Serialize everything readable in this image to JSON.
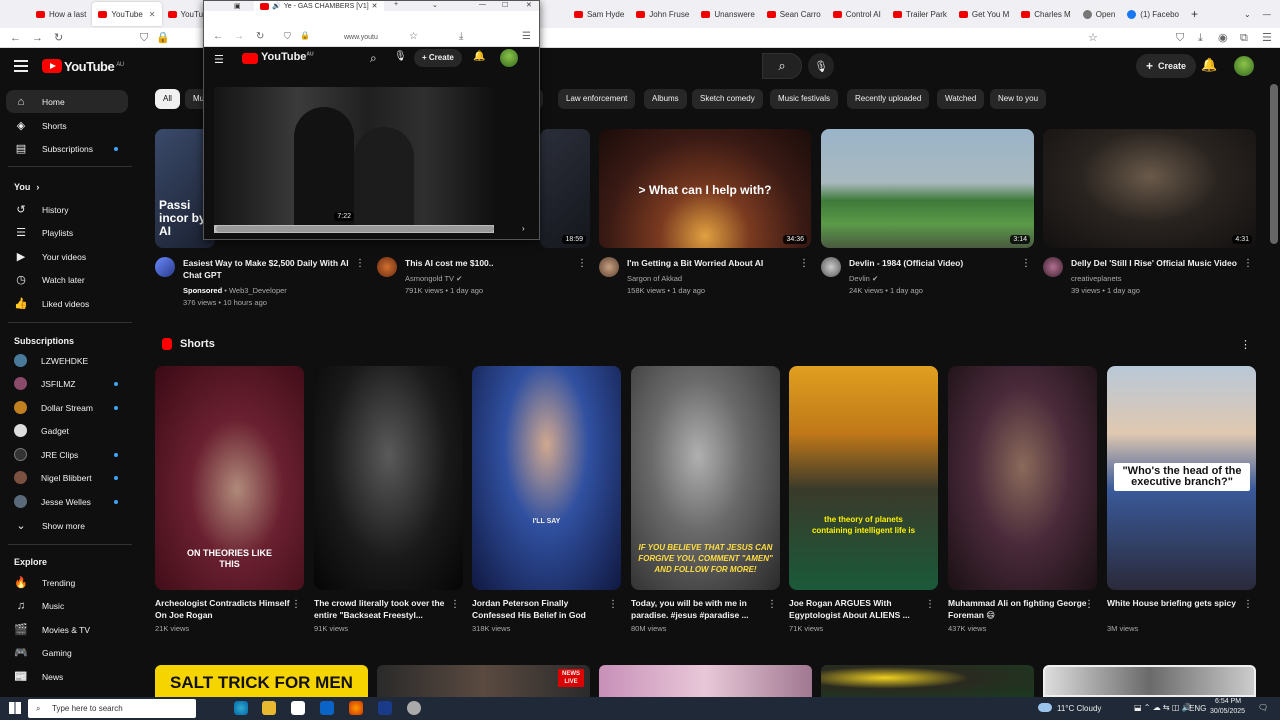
{
  "browser_tabs": [
    {
      "label": "How a last"
    },
    {
      "label": "YouTube",
      "active": true
    },
    {
      "label": "YouTube"
    },
    {
      "label": "Sam Hyde"
    },
    {
      "label": "John Fruse"
    },
    {
      "label": "Unanswere"
    },
    {
      "label": "Sean Carro"
    },
    {
      "label": "Control AI"
    },
    {
      "label": "Trailer Park"
    },
    {
      "label": "Get You M"
    },
    {
      "label": "Charles M"
    },
    {
      "label": "Open"
    },
    {
      "label": "(1) Facebo"
    }
  ],
  "popup": {
    "tab_title": "Ye - GAS CHAMBERS [V1]",
    "url": "www.youtu",
    "create": "Create",
    "logo": "YouTube",
    "region": "AU",
    "time_a": "7:22"
  },
  "header": {
    "logo": "YouTube",
    "region": "AU",
    "create": "Create"
  },
  "sidebar": {
    "main": [
      {
        "label": "Home",
        "icon": "⌂"
      },
      {
        "label": "Shorts",
        "icon": "◈"
      },
      {
        "label": "Subscriptions",
        "icon": "▤",
        "dot": true
      }
    ],
    "you_header": "You",
    "you": [
      {
        "label": "History",
        "icon": "↺"
      },
      {
        "label": "Playlists",
        "icon": "☰"
      },
      {
        "label": "Your videos",
        "icon": "▶"
      },
      {
        "label": "Watch later",
        "icon": "◷"
      },
      {
        "label": "Liked videos",
        "icon": "👍"
      }
    ],
    "subs_header": "Subscriptions",
    "subs": [
      {
        "label": "LZWEHDKE",
        "color": "#4a7a9a"
      },
      {
        "label": "JSFILMZ",
        "color": "#8a4a6a",
        "dot": true
      },
      {
        "label": "Dollar Stream",
        "color": "#c08020",
        "dot": true
      },
      {
        "label": "Gadget",
        "color": "#ddd"
      },
      {
        "label": "JRE Clips",
        "color": "#333",
        "dot": true
      },
      {
        "label": "Nigel Blibbert",
        "color": "#7a5040",
        "dot": true
      },
      {
        "label": "Jesse Welles",
        "color": "#5a6a7a",
        "dot": true
      },
      {
        "label": "Show more",
        "icon": "⌄"
      }
    ],
    "explore_header": "Explore",
    "explore": [
      {
        "label": "Trending",
        "icon": "🔥"
      },
      {
        "label": "Music",
        "icon": "♫"
      },
      {
        "label": "Movies & TV",
        "icon": "🎬"
      },
      {
        "label": "Gaming",
        "icon": "🎮"
      },
      {
        "label": "News",
        "icon": "📰"
      }
    ]
  },
  "chips": [
    "All",
    "Mu",
    "s",
    "Law enforcement",
    "Albums",
    "Sketch comedy",
    "Music festivals",
    "Recently uploaded",
    "Watched",
    "New to you"
  ],
  "videos": [
    {
      "title": "Easiest Way to Make $2,500 Daily With AI Chat GPT",
      "sponsored": "Sponsored",
      "channel": "Web3_Developer",
      "meta": "376 views • 10 hours ago",
      "duration": "",
      "overlay": "Passi incor by AI"
    },
    {
      "title": "This AI cost me $100..",
      "channel": "Asmongold TV",
      "meta": "791K views • 1 day ago",
      "duration": "18:59"
    },
    {
      "title": "I'm Getting a Bit Worried About AI",
      "channel": "Sargon of Akkad",
      "meta": "158K views • 1 day ago",
      "duration": "34:36",
      "overlay": "> What can I help with?"
    },
    {
      "title": "Devlin - 1984 (Official Video)",
      "channel": "Devlin",
      "meta": "24K views • 1 day ago",
      "duration": "3:14"
    },
    {
      "title": "Delly Del 'Still I Rise' Official Music Video",
      "channel": "creativeplanets",
      "meta": "39 views • 1 day ago",
      "duration": "4:31"
    }
  ],
  "shorts_header": "Shorts",
  "shorts": [
    {
      "title": "Archeologist Contradicts Himself On Joe Rogan",
      "views": "21K views",
      "caption": "ON THEORIES LIKE THIS"
    },
    {
      "title": "The crowd literally took over the entire \"Backseat Freestyl...",
      "views": "91K views",
      "caption": ""
    },
    {
      "title": "Jordan Peterson Finally Confessed His Belief in God",
      "views": "318K views",
      "caption": "I'LL SAY"
    },
    {
      "title": "Today, you will be with me in paradise. #jesus #paradise ...",
      "views": "80M views",
      "caption": "IF YOU BELIEVE THAT JESUS CAN FORGIVE YOU, COMMENT \"AMEN\" AND FOLLOW FOR MORE!"
    },
    {
      "title": "Joe Rogan ARGUES With Egyptologist About ALIENS ...",
      "views": "71K views",
      "caption": "the theory of planets containing intelligent life is"
    },
    {
      "title": "Muhammad Ali on fighting George Foreman 😄",
      "views": "437K views",
      "caption": ""
    },
    {
      "title": "White House briefing gets spicy",
      "views": "3M views",
      "caption": "\"Who's the head of the executive branch?\""
    }
  ],
  "bottom_row": [
    {
      "text": "SALT TRICK FOR MEN"
    },
    {
      "text": "NEWS LIVE"
    },
    {
      "text": ""
    },
    {
      "text": ""
    },
    {
      "text": ""
    }
  ],
  "taskbar": {
    "search_placeholder": "Type here to search",
    "weather": "11°C  Cloudy",
    "lang": "ENG",
    "time": "6:54 PM",
    "date": "30/05/2025"
  }
}
